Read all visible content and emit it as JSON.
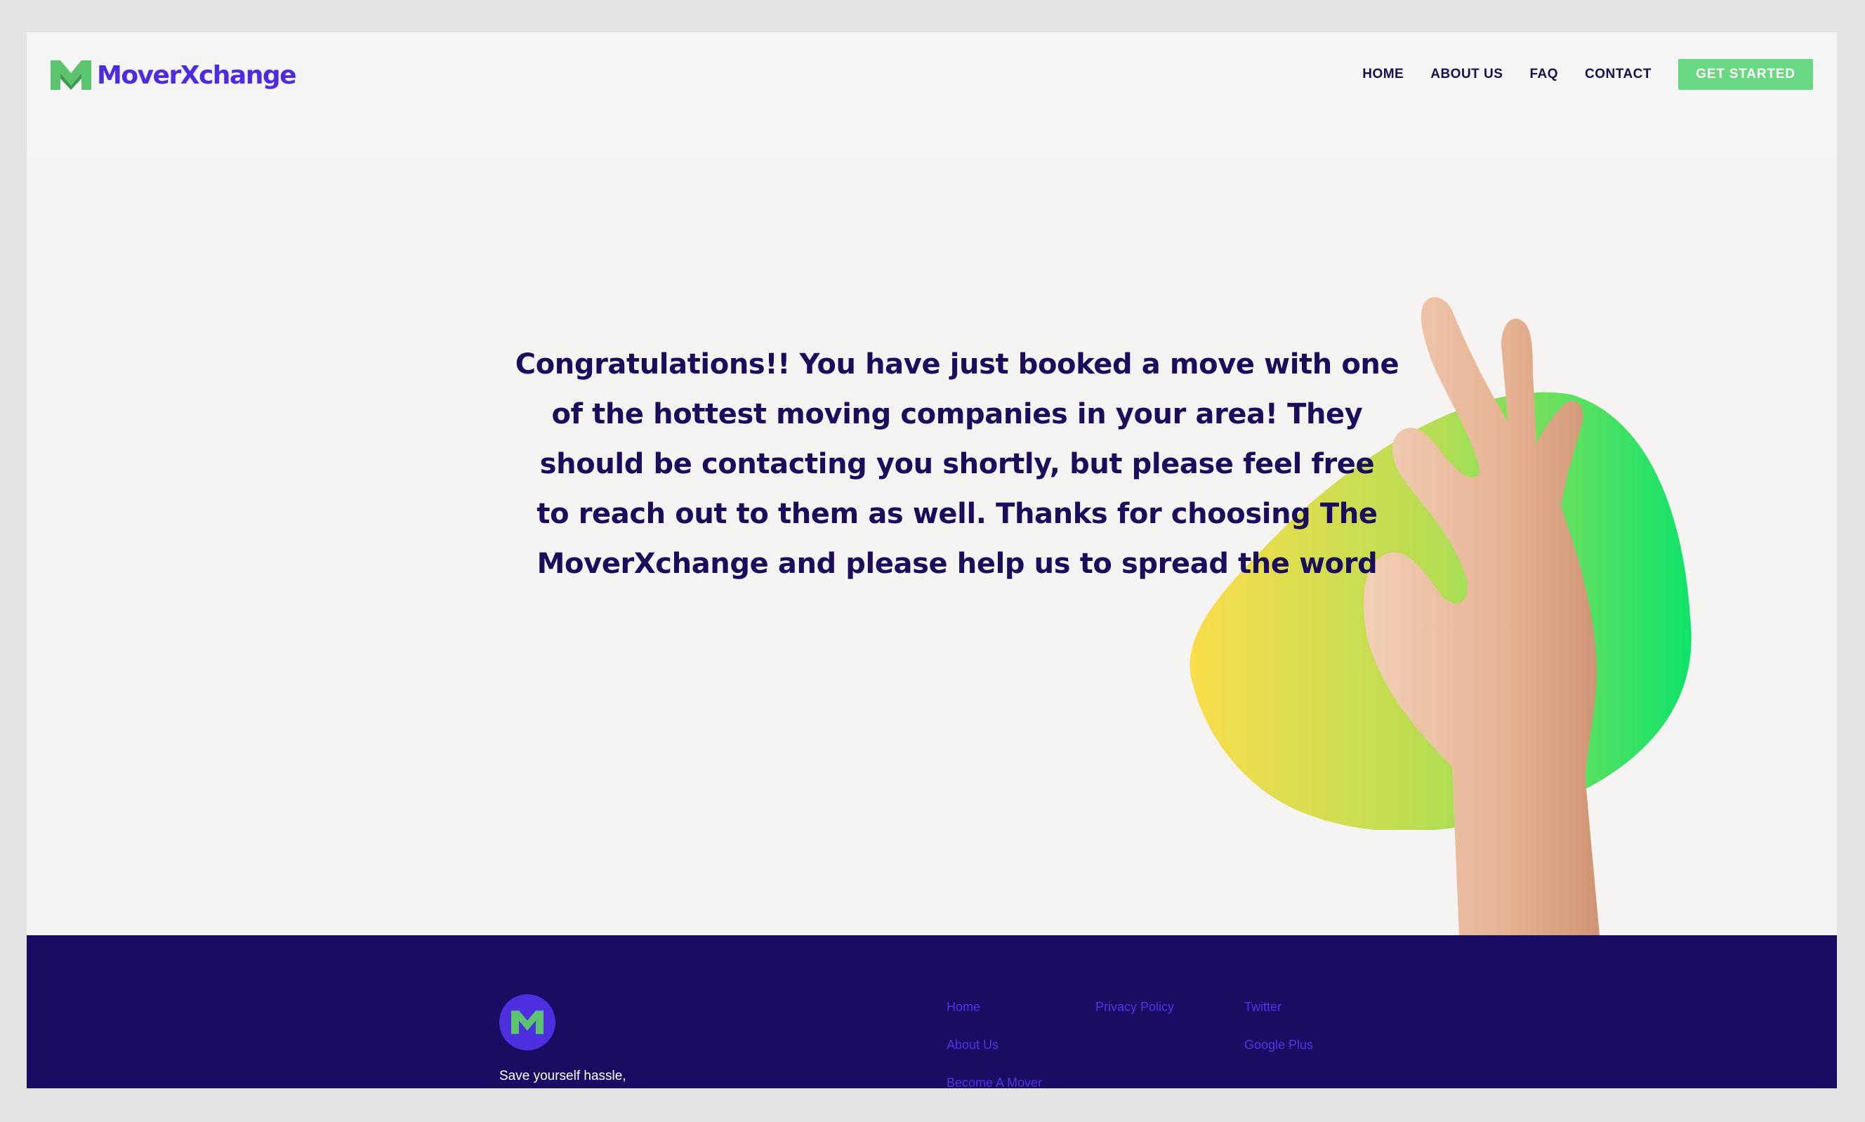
{
  "brand": {
    "name": "MoverXchange",
    "primary_color": "#4e2be0",
    "accent_color": "#6ad883",
    "dark_color": "#190c63"
  },
  "nav": {
    "items": [
      {
        "label": "HOME"
      },
      {
        "label": "ABOUT US"
      },
      {
        "label": "FAQ"
      },
      {
        "label": "CONTACT"
      }
    ],
    "cta_label": "GET STARTED"
  },
  "hero": {
    "message_lines": [
      "Congratulations!! You have just booked a move with one",
      "of the hottest moving companies in your area! They",
      "should be contacting you shortly, but please feel free",
      "to reach out to them as well. Thanks for choosing The",
      "MoverXchange and please help us to spread the word"
    ],
    "image_icon": "ok-hand-icon"
  },
  "footer": {
    "tagline": "Save yourself hassle,",
    "col1": [
      {
        "label": "Home"
      },
      {
        "label": "About Us"
      },
      {
        "label": "Become A Mover"
      }
    ],
    "col2": [
      {
        "label": "Privacy Policy"
      }
    ],
    "col3": [
      {
        "label": "Twitter"
      },
      {
        "label": "Google Plus"
      }
    ]
  }
}
